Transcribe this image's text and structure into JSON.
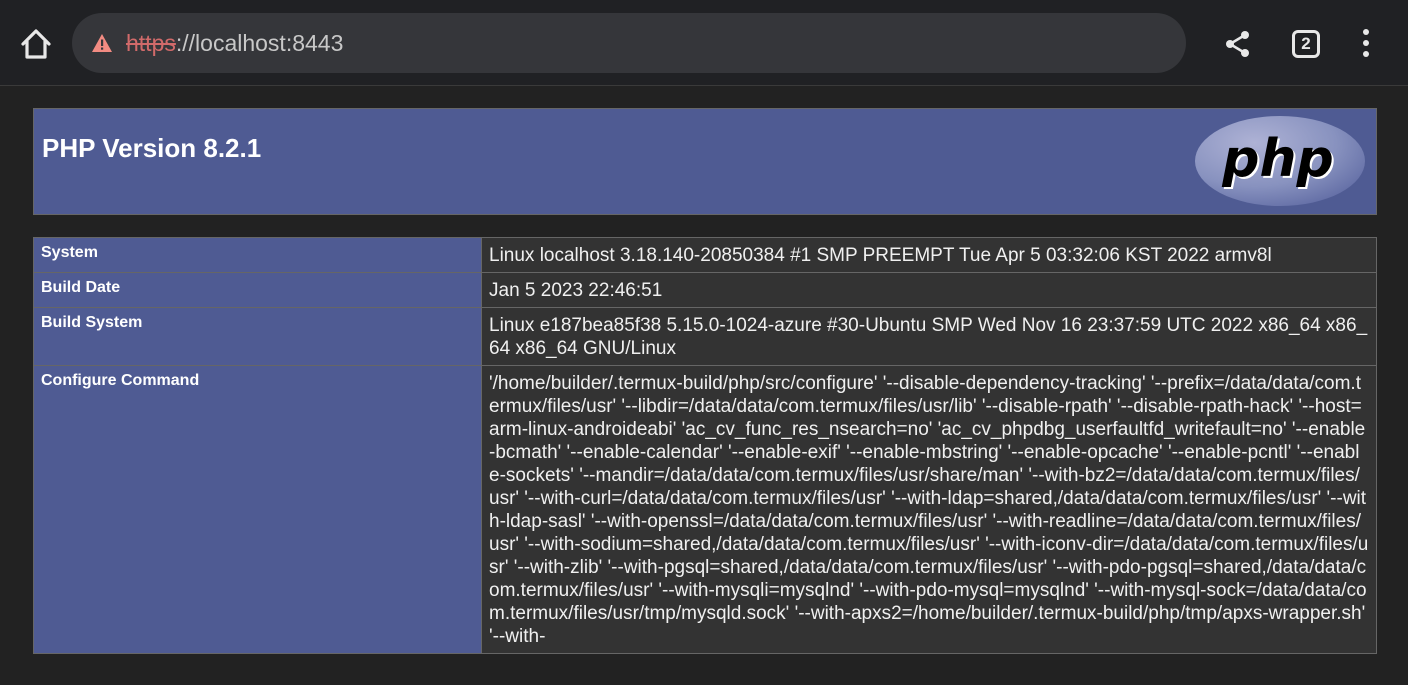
{
  "browser": {
    "url_scheme": "https",
    "url_rest": "://localhost:8443",
    "tab_count": "2"
  },
  "phpinfo": {
    "title": "PHP Version 8.2.1",
    "logo_text": "php",
    "rows": [
      {
        "label": "System",
        "value": "Linux localhost 3.18.140-20850384 #1 SMP PREEMPT Tue Apr 5 03:32:06 KST 2022 armv8l"
      },
      {
        "label": "Build Date",
        "value": "Jan 5 2023 22:46:51"
      },
      {
        "label": "Build System",
        "value": "Linux e187bea85f38 5.15.0-1024-azure #30-Ubuntu SMP Wed Nov 16 23:37:59 UTC 2022 x86_64 x86_64 x86_64 GNU/Linux"
      },
      {
        "label": "Configure Command",
        "value": "'/home/builder/.termux-build/php/src/configure' '--disable-dependency-tracking' '--prefix=/data/data/com.termux/files/usr' '--libdir=/data/data/com.termux/files/usr/lib' '--disable-rpath' '--disable-rpath-hack' '--host=arm-linux-androideabi' 'ac_cv_func_res_nsearch=no' 'ac_cv_phpdbg_userfaultfd_writefault=no' '--enable-bcmath' '--enable-calendar' '--enable-exif' '--enable-mbstring' '--enable-opcache' '--enable-pcntl' '--enable-sockets' '--mandir=/data/data/com.termux/files/usr/share/man' '--with-bz2=/data/data/com.termux/files/usr' '--with-curl=/data/data/com.termux/files/usr' '--with-ldap=shared,/data/data/com.termux/files/usr' '--with-ldap-sasl' '--with-openssl=/data/data/com.termux/files/usr' '--with-readline=/data/data/com.termux/files/usr' '--with-sodium=shared,/data/data/com.termux/files/usr' '--with-iconv-dir=/data/data/com.termux/files/usr' '--with-zlib' '--with-pgsql=shared,/data/data/com.termux/files/usr' '--with-pdo-pgsql=shared,/data/data/com.termux/files/usr' '--with-mysqli=mysqlnd' '--with-pdo-mysql=mysqlnd' '--with-mysql-sock=/data/data/com.termux/files/usr/tmp/mysqld.sock' '--with-apxs2=/home/builder/.termux-build/php/tmp/apxs-wrapper.sh' '--with-"
      }
    ]
  },
  "colors": {
    "header_bg": "#4f5b93",
    "value_bg": "#333333",
    "page_bg": "#222222",
    "toolbar_bg": "#202124",
    "urlbar_bg": "#35363a",
    "warning": "#f28b82"
  },
  "icons": {
    "home": "home-icon",
    "warning": "warning-icon",
    "share": "share-icon",
    "tabs": "tab-switcher-icon",
    "menu": "more-vert-icon"
  }
}
